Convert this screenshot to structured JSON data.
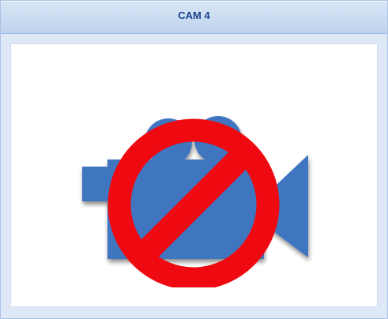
{
  "panel": {
    "title": "CAM 4"
  },
  "feed": {
    "status_icon": "no-camera-icon",
    "camera_color": "#3f74c0",
    "prohibition_color": "#ee0a10"
  }
}
